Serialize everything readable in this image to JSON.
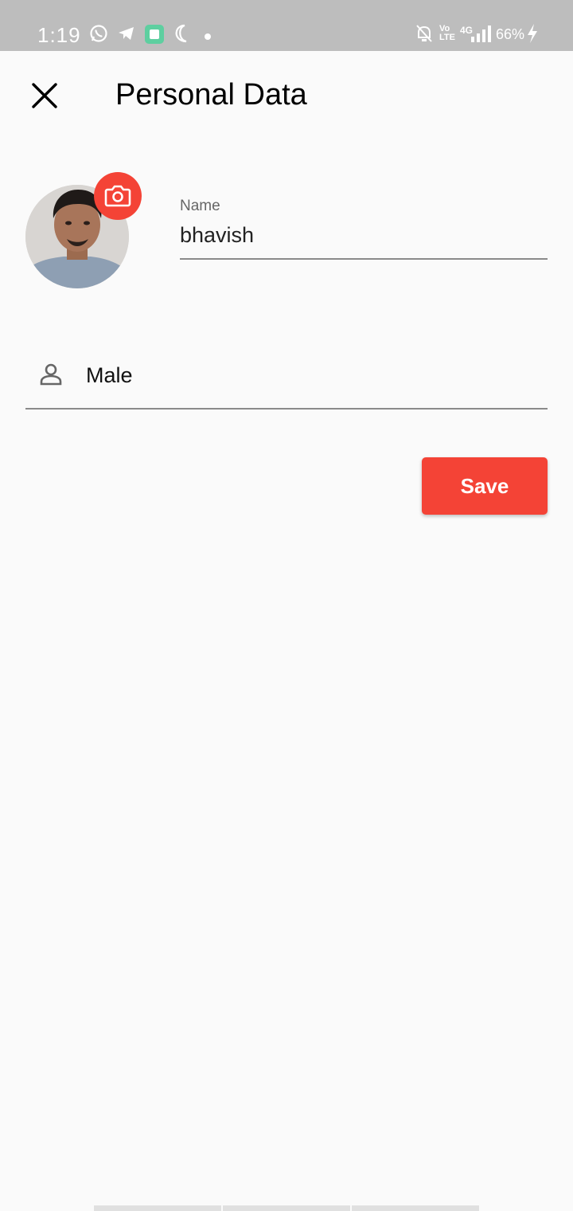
{
  "status_bar": {
    "time": "1:19",
    "battery_percent": "66%",
    "network": "4G",
    "icons": [
      "whatsapp-icon",
      "telegram-icon",
      "app-icon",
      "moon-icon",
      "dot-icon",
      "mute-icon",
      "volte-icon",
      "signal-icon",
      "charging-icon"
    ]
  },
  "header": {
    "title": "Personal Data",
    "close_icon": "close-icon"
  },
  "profile": {
    "camera_icon": "camera-icon",
    "name_label": "Name",
    "name_value": "bhavish",
    "gender_icon": "person-icon",
    "gender_value": "Male"
  },
  "actions": {
    "save_label": "Save"
  },
  "colors": {
    "accent": "#f44336",
    "status_bar": "#bdbdbd",
    "background": "#fafafa"
  }
}
